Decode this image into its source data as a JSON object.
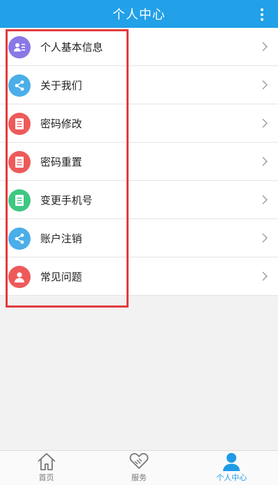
{
  "header": {
    "title": "个人中心"
  },
  "menu": [
    {
      "label": "个人基本信息",
      "icon": "profile-card-icon",
      "color": "#8a78e6"
    },
    {
      "label": "关于我们",
      "icon": "share-icon",
      "color": "#4aaee9"
    },
    {
      "label": "密码修改",
      "icon": "document-icon",
      "color": "#ee5a5a"
    },
    {
      "label": "密码重置",
      "icon": "document-icon",
      "color": "#ee5a5a"
    },
    {
      "label": "变更手机号",
      "icon": "document-icon",
      "color": "#3ec882"
    },
    {
      "label": "账户注销",
      "icon": "share-icon",
      "color": "#4aaee9"
    },
    {
      "label": "常见问题",
      "icon": "user-icon",
      "color": "#ee5a5a"
    }
  ],
  "tabs": [
    {
      "label": "首页",
      "icon": "home-icon"
    },
    {
      "label": "服务",
      "icon": "handshake-icon"
    },
    {
      "label": "个人中心",
      "icon": "user-icon",
      "active": true
    }
  ],
  "colors": {
    "primary": "#22a0e8",
    "highlight": "#e23b3b"
  }
}
